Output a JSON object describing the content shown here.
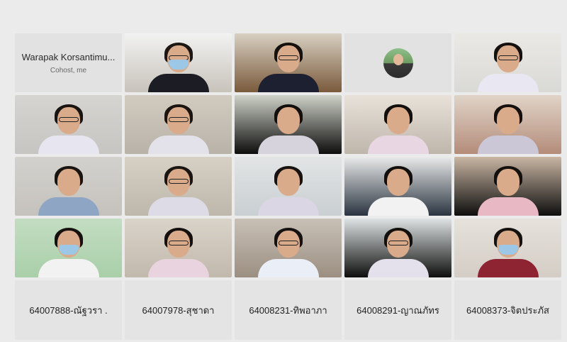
{
  "tiles": [
    {
      "kind": "name",
      "title": "Warapak Korsantimu...",
      "subtitle": "Cohost, me"
    },
    {
      "kind": "video",
      "bg": "#c8c3bb",
      "top": "#f2f2f2",
      "shirt": "#1c1c24",
      "hair": "#1c1714",
      "mask": true,
      "glasses": true
    },
    {
      "kind": "video",
      "bg": "#7a5a3c",
      "top": "#d8d0c2",
      "shirt": "#1d2030",
      "hair": "#14110f",
      "mask": false,
      "glasses": true
    },
    {
      "kind": "avatar"
    },
    {
      "kind": "video",
      "bg": "#d9d9d6",
      "top": "#ebe9e4",
      "shirt": "#e9e7f1",
      "hair": "#15110f",
      "mask": false,
      "glasses": true
    },
    {
      "kind": "video",
      "bg": "#c7c5c2",
      "top": "#d6d4d1",
      "shirt": "#e7e5ef",
      "hair": "#1b1512",
      "mask": false,
      "glasses": true
    },
    {
      "kind": "video",
      "bg": "#b8b2a8",
      "top": "#d1cbc0",
      "shirt": "#e3e1ea",
      "hair": "#1a1511",
      "mask": false,
      "glasses": true
    },
    {
      "kind": "video",
      "bg": "#0d0d0d",
      "top": "#cfd2c8",
      "shirt": "#d7d3dd",
      "hair": "#120f0c",
      "mask": false,
      "glasses": false
    },
    {
      "kind": "video",
      "bg": "#bfb6ab",
      "top": "#e8e2da",
      "shirt": "#e8d7e2",
      "hair": "#120f0c",
      "mask": false,
      "glasses": false
    },
    {
      "kind": "video",
      "bg": "#b48c7a",
      "top": "#e0d4c8",
      "shirt": "#cbc7d6",
      "hair": "#15100d",
      "mask": false,
      "glasses": false
    },
    {
      "kind": "video",
      "bg": "#c5c2bd",
      "top": "#d3d1cd",
      "shirt": "#8ea6c4",
      "hair": "#1a1410",
      "mask": false,
      "glasses": false
    },
    {
      "kind": "video",
      "bg": "#beb7ab",
      "top": "#d6d0c5",
      "shirt": "#dcdbe6",
      "hair": "#1b1511",
      "mask": false,
      "glasses": true
    },
    {
      "kind": "video",
      "bg": "#c9cfd2",
      "top": "#e2e4e5",
      "shirt": "#dad6e4",
      "hair": "#171210",
      "mask": false,
      "glasses": false
    },
    {
      "kind": "video",
      "bg": "#2a3440",
      "top": "#e9eaea",
      "shirt": "#f2f2f2",
      "hair": "#120f0d",
      "mask": false,
      "glasses": false
    },
    {
      "kind": "video",
      "bg": "#0e0e0e",
      "top": "#c9b6a3",
      "shirt": "#e8b9c4",
      "hair": "#14100d",
      "mask": false,
      "glasses": false
    },
    {
      "kind": "video",
      "bg": "#a9cfa8",
      "top": "#c3ddc2",
      "shirt": "#f2f2f2",
      "hair": "#16110e",
      "mask": true,
      "glasses": false
    },
    {
      "kind": "video",
      "bg": "#c2b9ad",
      "top": "#dad3c9",
      "shirt": "#e8d3de",
      "hair": "#15100d",
      "mask": false,
      "glasses": true
    },
    {
      "kind": "video",
      "bg": "#9c8f82",
      "top": "#c8c0b6",
      "shirt": "#e9eef7",
      "hair": "#141110",
      "mask": false,
      "glasses": true
    },
    {
      "kind": "video",
      "bg": "#0e0e0e",
      "top": "#dde2e2",
      "shirt": "#e4e0ec",
      "hair": "#120f0d",
      "mask": false,
      "glasses": true
    },
    {
      "kind": "video",
      "bg": "#d4cdc6",
      "top": "#e6e1db",
      "shirt": "#8e2432",
      "hair": "#15110e",
      "mask": true,
      "glasses": false
    },
    {
      "kind": "label",
      "title": "64007888-ณัฐวรา ."
    },
    {
      "kind": "label",
      "title": "64007978-สุชาดา"
    },
    {
      "kind": "label",
      "title": "64008231-ทิพอาภา"
    },
    {
      "kind": "label",
      "title": "64008291-ญาณภัทร"
    },
    {
      "kind": "label",
      "title": "64008373-จิตประภัส"
    }
  ]
}
